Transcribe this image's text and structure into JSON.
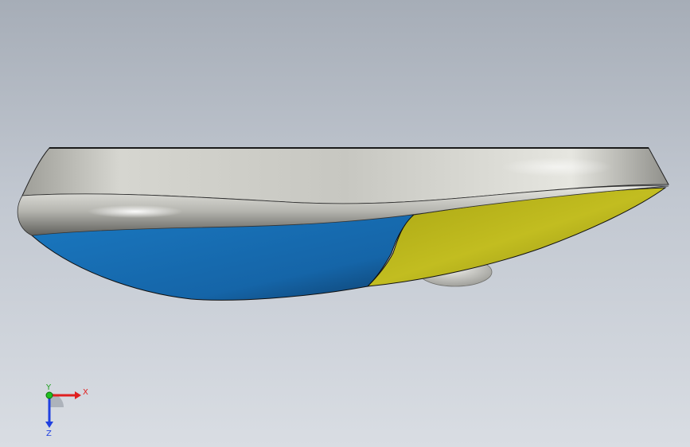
{
  "viewport": {
    "background_top": "#a6adb7",
    "background_bottom": "#d9dde3"
  },
  "model": {
    "shell_color": "#c9c9c4",
    "blue_face_color": "#1670b8",
    "yellow_face_color": "#b7b21a",
    "edge_color": "#111111"
  },
  "triad": {
    "x_label": "X",
    "y_label": "Y",
    "z_label": "Z",
    "x_color": "#e02020",
    "y_color": "#20c020",
    "z_color": "#2040e0"
  }
}
